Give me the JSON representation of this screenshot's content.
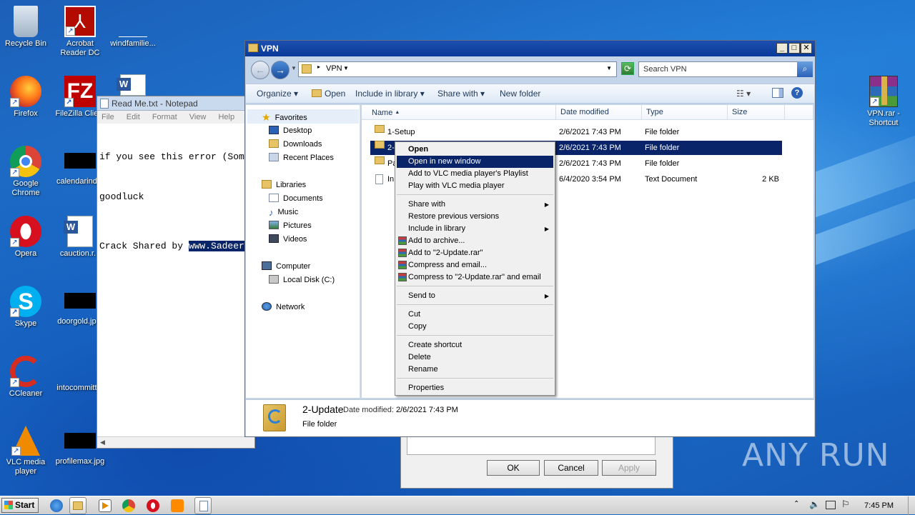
{
  "desktop_icons": [
    {
      "label": "Recycle Bin"
    },
    {
      "label": "Acrobat Reader DC"
    },
    {
      "label": "windfamilie..."
    },
    {
      "label": "Firefox"
    },
    {
      "label": "FileZilla Clie..."
    },
    {
      "label": "Google Chrome"
    },
    {
      "label": "calendarind..."
    },
    {
      "label": "Opera"
    },
    {
      "label": "cauction.r..."
    },
    {
      "label": "Skype"
    },
    {
      "label": "doorgold.jp..."
    },
    {
      "label": "CCleaner"
    },
    {
      "label": "intocommitt..."
    },
    {
      "label": "VLC media player"
    },
    {
      "label": "profilemax.jpg"
    },
    {
      "label": "VPN.rar - Shortcut"
    }
  ],
  "notepad": {
    "title": "Read Me.txt - Notepad",
    "menu": [
      "File",
      "Edit",
      "Format",
      "View",
      "Help"
    ],
    "line1": "if you see this error (Som",
    "line2": "goodluck",
    "line3_prefix": "Crack Shared by ",
    "line3_selected": "www.Sadeer"
  },
  "dialog": {
    "ok": "OK",
    "cancel": "Cancel",
    "apply": "Apply"
  },
  "explorer": {
    "title": "VPN",
    "breadcrumb": "VPN",
    "search_placeholder": "Search VPN",
    "toolbar": {
      "organize": "Organize",
      "open": "Open",
      "include": "Include in library",
      "share": "Share with",
      "new_folder": "New folder"
    },
    "nav": {
      "favorites": "Favorites",
      "desktop": "Desktop",
      "downloads": "Downloads",
      "recent": "Recent Places",
      "libraries": "Libraries",
      "documents": "Documents",
      "music": "Music",
      "pictures": "Pictures",
      "videos": "Videos",
      "computer": "Computer",
      "local_disk": "Local Disk (C:)",
      "network": "Network"
    },
    "columns": {
      "name": "Name",
      "date": "Date modified",
      "type": "Type",
      "size": "Size"
    },
    "files": [
      {
        "name": "1-Setup",
        "date": "2/6/2021 7:43 PM",
        "type": "File folder",
        "size": ""
      },
      {
        "name": "2-",
        "date": "2/6/2021 7:43 PM",
        "type": "File folder",
        "size": ""
      },
      {
        "name": "Pa",
        "date": "2/6/2021 7:43 PM",
        "type": "File folder",
        "size": ""
      },
      {
        "name": "In",
        "date": "6/4/2020 3:54 PM",
        "type": "Text Document",
        "size": "2 KB"
      }
    ],
    "details": {
      "name": "2-Update",
      "date_label": "Date modified:",
      "date": "2/6/2021 7:43 PM",
      "type": "File folder"
    }
  },
  "context_menu": {
    "open": "Open",
    "open_new_window": "Open in new window",
    "vlc_playlist": "Add to VLC media player's Playlist",
    "vlc_play": "Play with VLC media player",
    "share_with": "Share with",
    "restore": "Restore previous versions",
    "include": "Include in library",
    "add_archive": "Add to archive...",
    "add_rar": "Add to \"2-Update.rar\"",
    "compress_email": "Compress and email...",
    "compress_rar_email": "Compress to \"2-Update.rar\" and email",
    "send_to": "Send to",
    "cut": "Cut",
    "copy": "Copy",
    "create_shortcut": "Create shortcut",
    "delete": "Delete",
    "rename": "Rename",
    "properties": "Properties"
  },
  "taskbar": {
    "start": "Start",
    "time": "7:45 PM"
  },
  "watermark": "ANY RUN"
}
